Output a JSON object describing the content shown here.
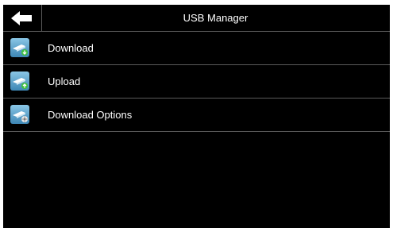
{
  "header": {
    "title": "USB Manager",
    "back_icon": "back-arrow-icon"
  },
  "menu": {
    "items": [
      {
        "label": "Download",
        "icon": "usb-download-icon",
        "badge_color": "#3fbf3f"
      },
      {
        "label": "Upload",
        "icon": "usb-upload-icon",
        "badge_color": "#3fbf3f"
      },
      {
        "label": "Download Options",
        "icon": "usb-download-options-icon",
        "badge_color": "#e8e8e8"
      }
    ]
  },
  "colors": {
    "background": "#000000",
    "text": "#ffffff",
    "divider": "#5a5a5a",
    "icon_tile": "#5a9fc4"
  }
}
